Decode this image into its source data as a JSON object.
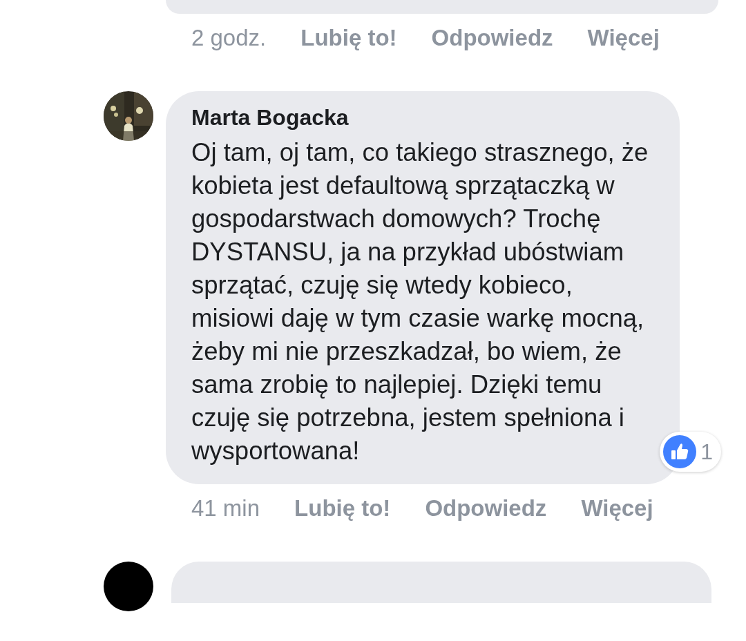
{
  "comments": [
    {
      "kind": "cut_top",
      "actions": {
        "time": "2 godz.",
        "like": "Lubię to!",
        "reply": "Odpowiedz",
        "more": "Więcej"
      }
    },
    {
      "kind": "full",
      "author": "Marta Bogacka",
      "text": "Oj tam, oj tam, co takiego strasznego, że kobieta jest defaultową sprzątaczką w gospodarstwach domowych? Trochę DYSTANSU, ja na przykład ubóstwiam sprzątać, czuję się wtedy kobieco, misiowi daję w tym czasie warkę mocną, żeby mi nie przeszkadzał, bo wiem, że sama zrobię to najlepiej. Dzięki temu czuję się potrzebna, jestem spełniona i wysportowana!",
      "reactions": {
        "count": "1"
      },
      "actions": {
        "time": "41 min",
        "like": "Lubię to!",
        "reply": "Odpowiedz",
        "more": "Więcej"
      }
    },
    {
      "kind": "cut_bottom"
    }
  ]
}
